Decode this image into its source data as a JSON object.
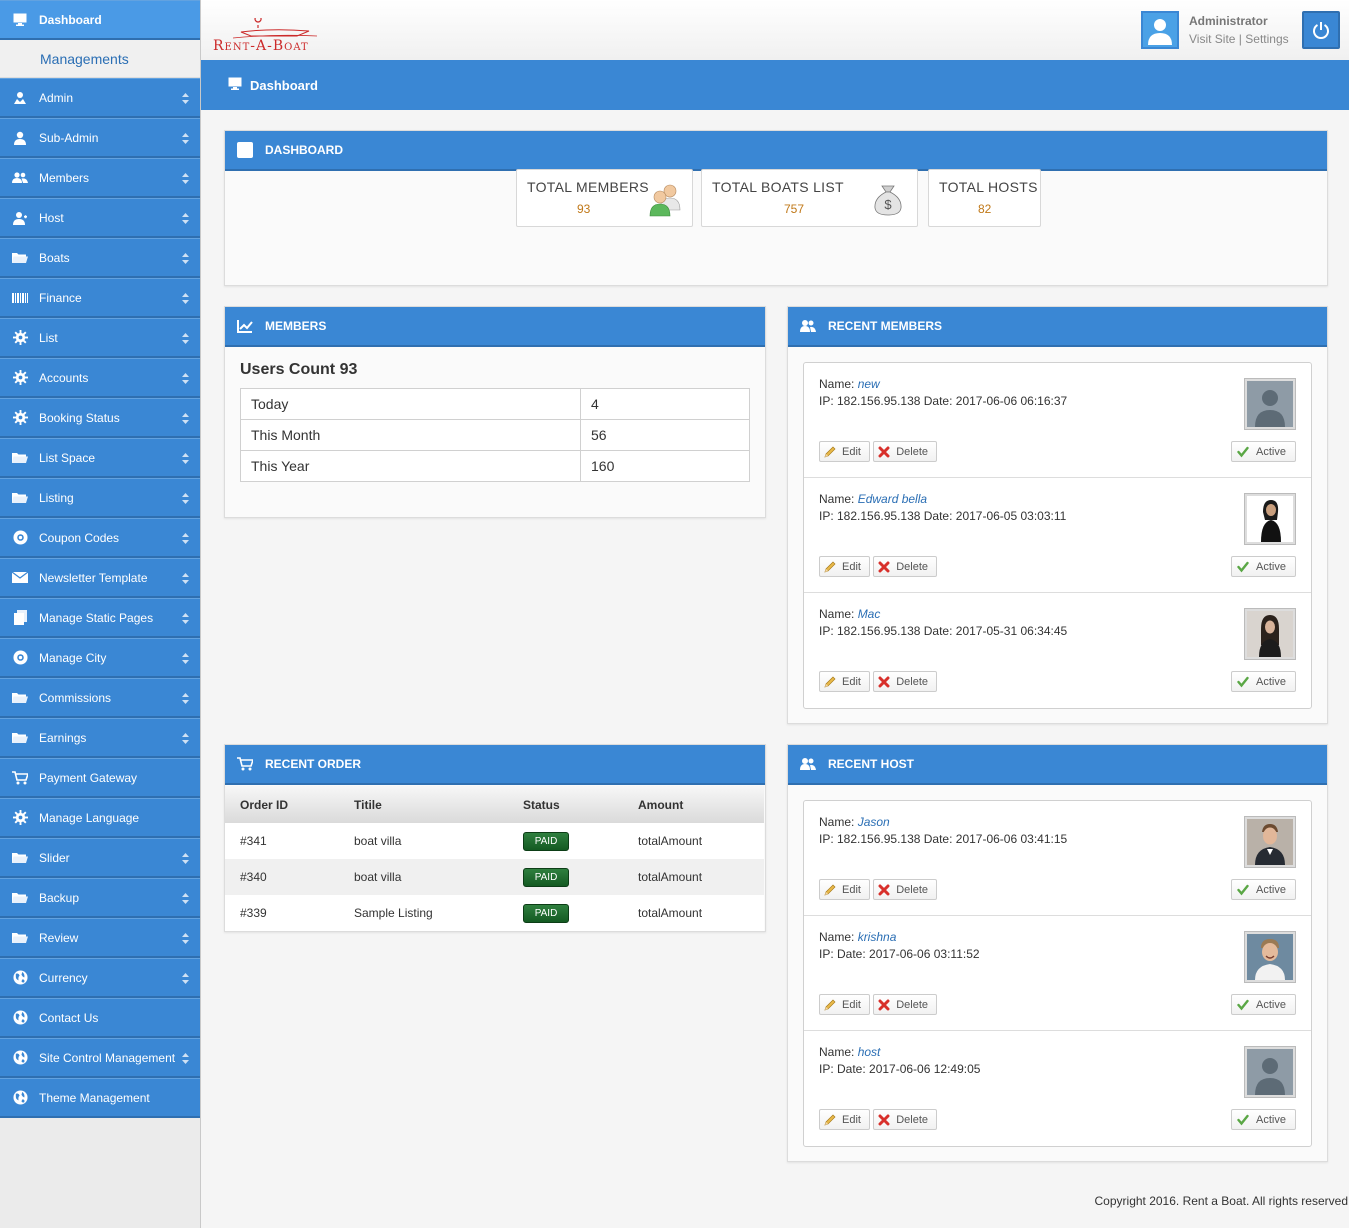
{
  "sidebar": {
    "dashboard": "Dashboard",
    "managements": "Managements",
    "items": [
      {
        "label": "Admin",
        "icon": "admin-icon",
        "arrow": true
      },
      {
        "label": "Sub-Admin",
        "icon": "user-icon",
        "arrow": true
      },
      {
        "label": "Members",
        "icon": "members-icon",
        "arrow": true
      },
      {
        "label": "Host",
        "icon": "host-icon",
        "arrow": true
      },
      {
        "label": "Boats",
        "icon": "folder-icon",
        "arrow": true
      },
      {
        "label": "Finance",
        "icon": "barcode-icon",
        "arrow": true
      },
      {
        "label": "List",
        "icon": "gear-icon",
        "arrow": true
      },
      {
        "label": "Accounts",
        "icon": "gear-icon",
        "arrow": true
      },
      {
        "label": "Booking Status",
        "icon": "gear-icon",
        "arrow": true
      },
      {
        "label": "List Space",
        "icon": "folder-icon",
        "arrow": true
      },
      {
        "label": "Listing",
        "icon": "folder-icon",
        "arrow": true
      },
      {
        "label": "Coupon Codes",
        "icon": "target-icon",
        "arrow": true
      },
      {
        "label": "Newsletter Template",
        "icon": "mail-icon",
        "arrow": true
      },
      {
        "label": "Manage Static Pages",
        "icon": "pages-icon",
        "arrow": true
      },
      {
        "label": "Manage City",
        "icon": "target-icon",
        "arrow": true
      },
      {
        "label": "Commissions",
        "icon": "folder-icon",
        "arrow": true
      },
      {
        "label": "Earnings",
        "icon": "folder-icon",
        "arrow": true
      },
      {
        "label": "Payment Gateway",
        "icon": "cart-icon",
        "arrow": false
      },
      {
        "label": "Manage Language",
        "icon": "gear-icon",
        "arrow": false
      },
      {
        "label": "Slider",
        "icon": "folder-icon",
        "arrow": true
      },
      {
        "label": "Backup",
        "icon": "folder-icon",
        "arrow": true
      },
      {
        "label": "Review",
        "icon": "folder-icon",
        "arrow": true
      },
      {
        "label": "Currency",
        "icon": "globe-icon",
        "arrow": true
      },
      {
        "label": "Contact Us",
        "icon": "globe-icon",
        "arrow": false
      },
      {
        "label": "Site Control Management",
        "icon": "globe-icon",
        "arrow": true
      },
      {
        "label": "Theme Management",
        "icon": "globe-icon",
        "arrow": false
      }
    ]
  },
  "header": {
    "logo_text": "Rent-A-Boat",
    "admin_name": "Administrator",
    "visit_site": "Visit Site",
    "separator": " | ",
    "settings": "Settings",
    "breadcrumb": "Dashboard"
  },
  "dashboard": {
    "title": "DASHBOARD",
    "stats": [
      {
        "title": "TOTAL MEMBERS",
        "value": "93",
        "icon": "members-icon"
      },
      {
        "title": "TOTAL BOATS LIST",
        "value": "757",
        "icon": "money-bag-icon"
      },
      {
        "title": "TOTAL HOSTS",
        "value": "82",
        "icon": ""
      }
    ]
  },
  "members_panel": {
    "title": "MEMBERS",
    "users_count": "Users Count 93",
    "rows": [
      {
        "label": "Today",
        "value": "4"
      },
      {
        "label": "This Month",
        "value": "56"
      },
      {
        "label": "This Year",
        "value": "160"
      }
    ]
  },
  "recent_members": {
    "title": "RECENT MEMBERS",
    "items": [
      {
        "name_label": "Name: ",
        "name": "new",
        "ip": "IP: 182.156.95.138 Date: 2017-06-06 06:16:37",
        "photo": "placeholder"
      },
      {
        "name_label": "Name: ",
        "name": "Edward bella",
        "ip": "IP: 182.156.95.138 Date: 2017-06-05 03:03:11",
        "photo": "woman-black"
      },
      {
        "name_label": "Name: ",
        "name": "Mac",
        "ip": "IP: 182.156.95.138 Date: 2017-05-31 06:34:45",
        "photo": "woman-dark"
      }
    ]
  },
  "recent_host": {
    "title": "RECENT HOST",
    "items": [
      {
        "name_label": "Name: ",
        "name": "Jason",
        "ip": "IP: 182.156.95.138 Date: 2017-06-06 03:41:15",
        "photo": "man-suit"
      },
      {
        "name_label": "Name: ",
        "name": "krishna",
        "ip": "IP: Date: 2017-06-06 03:11:52",
        "photo": "man-smile"
      },
      {
        "name_label": "Name: ",
        "name": "host",
        "ip": "IP: Date: 2017-06-06 12:49:05",
        "photo": "placeholder"
      }
    ]
  },
  "buttons": {
    "edit": "Edit",
    "delete": "Delete",
    "active": "Active"
  },
  "recent_order": {
    "title": "RECENT ORDER",
    "columns": [
      "Order ID",
      "Titile",
      "Status",
      "Amount"
    ],
    "rows": [
      {
        "id": "#341",
        "title": "boat villa",
        "status": "PAID",
        "amount": "totalAmount"
      },
      {
        "id": "#340",
        "title": "boat villa",
        "status": "PAID",
        "amount": "totalAmount"
      },
      {
        "id": "#339",
        "title": "Sample Listing",
        "status": "PAID",
        "amount": "totalAmount"
      }
    ]
  },
  "footer": "Copyright 2016. Rent a Boat. All rights reserved",
  "colors": {
    "accent": "#3a87d4",
    "accent_dark": "#2f6fb0",
    "paid": "#1e6b2e",
    "stat_value": "#c07818",
    "link": "#2a6eb4"
  }
}
